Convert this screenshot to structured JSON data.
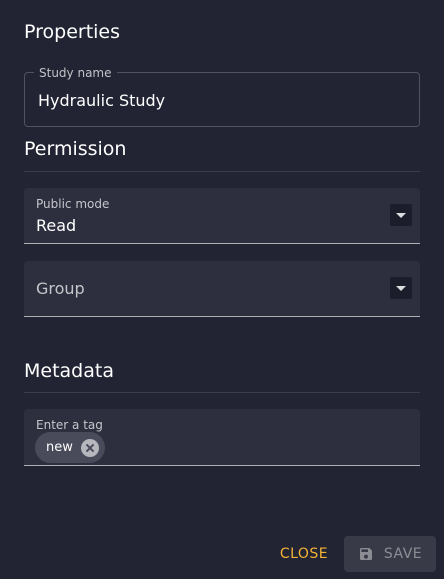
{
  "sections": {
    "properties_title": "Properties",
    "permission_title": "Permission",
    "metadata_title": "Metadata"
  },
  "study_name": {
    "label": "Study name",
    "value": "Hydraulic Study"
  },
  "public_mode": {
    "label": "Public mode",
    "value": "Read"
  },
  "group": {
    "placeholder": "Group"
  },
  "tags": {
    "label": "Enter a tag",
    "items": [
      "new"
    ]
  },
  "actions": {
    "close_label": "CLOSE",
    "save_label": "SAVE"
  },
  "colors": {
    "background": "#222333",
    "accent": "#f5b335",
    "field_fill": "#2d2e3e",
    "chip": "#4a4b5a"
  },
  "icons": {
    "select_arrow": "chevron-down-icon",
    "chip_delete": "cancel-circle-icon",
    "save": "floppy-disk-icon"
  }
}
